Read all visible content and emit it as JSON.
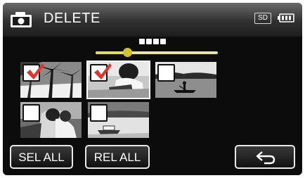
{
  "header": {
    "title": "DELETE",
    "camera_icon": "camera-icon",
    "sd_label": "SD",
    "battery_icon": "battery-icon"
  },
  "page_indicator": {
    "dot_count": 4,
    "position": 0.26
  },
  "thumbnails": [
    {
      "name": "palm-trees-beach",
      "checked": true
    },
    {
      "name": "woman-with-book",
      "checked": true
    },
    {
      "name": "canoe-on-lake",
      "checked": false
    },
    {
      "name": "couple-outdoors",
      "checked": false
    },
    {
      "name": "boat-on-water",
      "checked": false
    }
  ],
  "buttons": {
    "select_all": "SEL ALL",
    "release_all": "REL ALL",
    "back_icon": "return-arrow-icon"
  },
  "colors": {
    "checkmark": "#e8312a",
    "slider": "#e6dc52",
    "background": "#0c0c0c"
  }
}
